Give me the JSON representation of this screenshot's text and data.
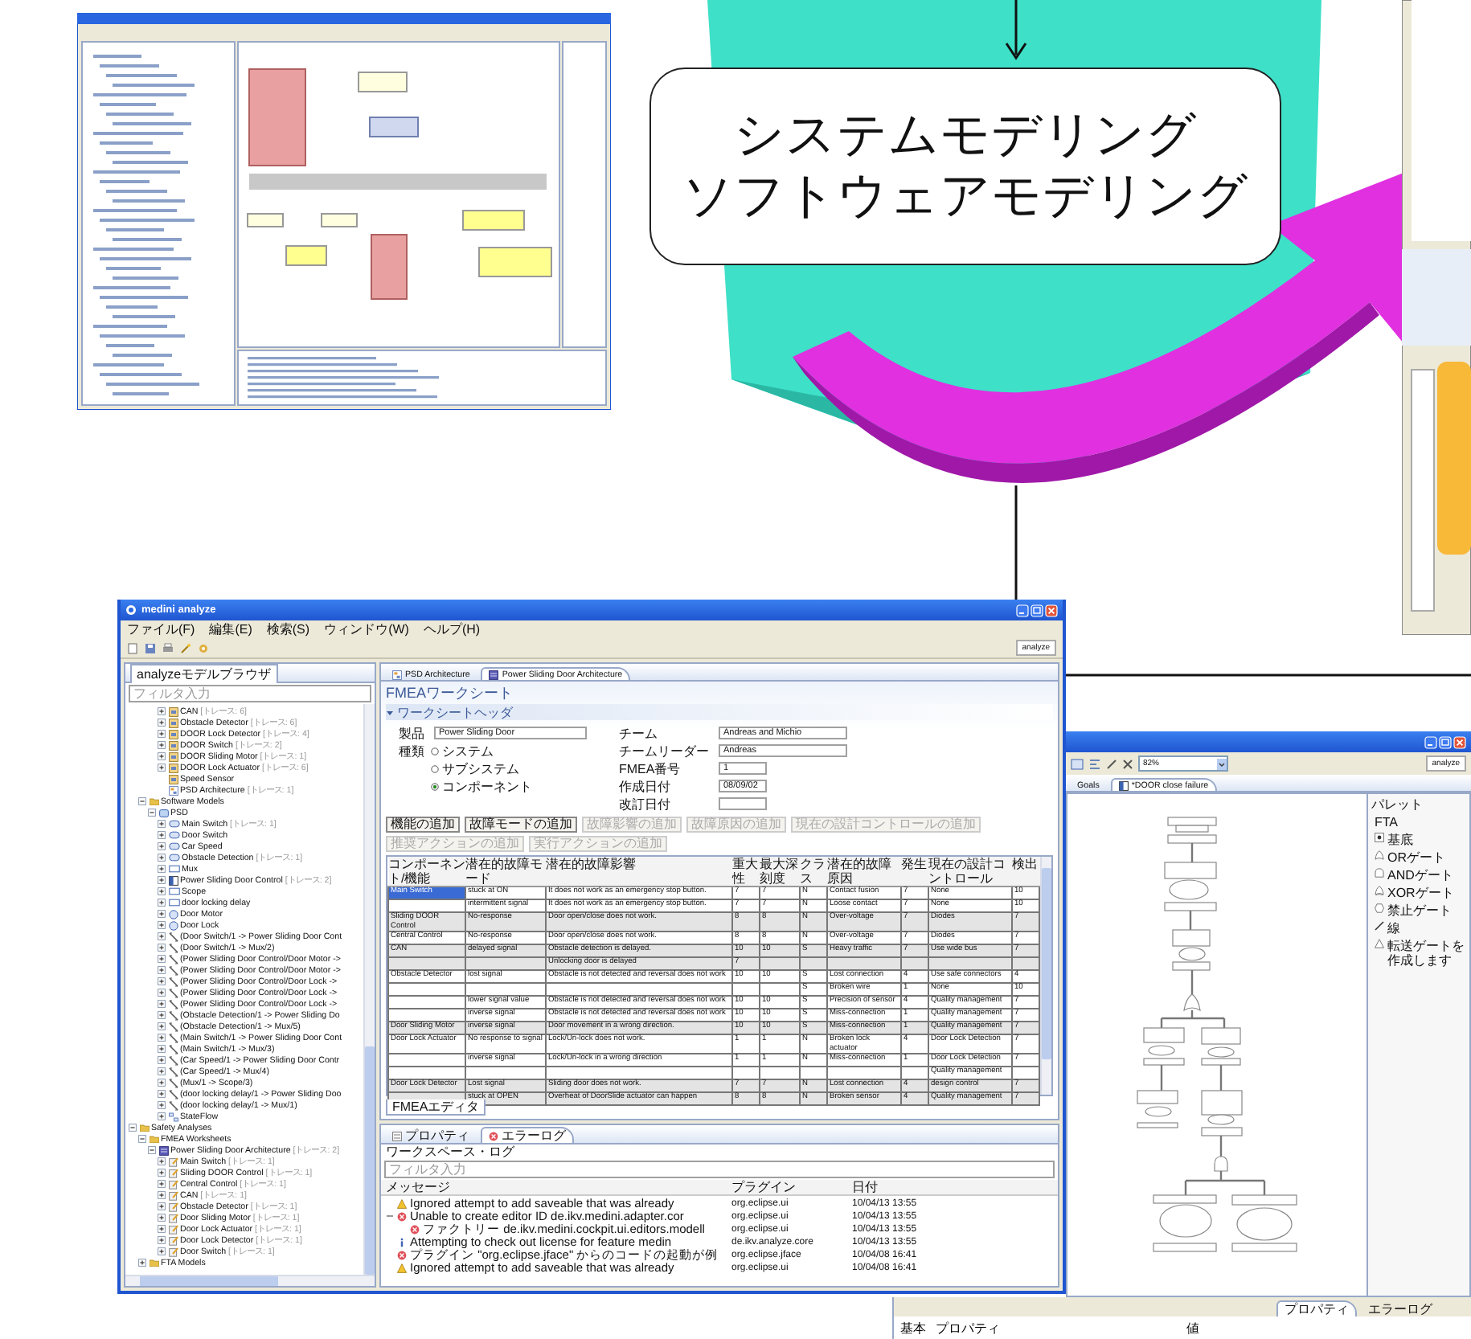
{
  "label_box": {
    "lines": [
      "システムモデリング",
      "ソフトウェアモデリング"
    ]
  },
  "main_window": {
    "title": "medini analyze",
    "menu": [
      "ファイル(F)",
      "編集(E)",
      "検索(S)",
      "ウィンドウ(W)",
      "ヘルプ(H)"
    ],
    "perspective": "analyze",
    "explorer": {
      "tab": "analyzeモデルブラウザ",
      "filter_placeholder": "フィルタ入力",
      "tree": [
        {
          "children": [
            {
              "children": [
                {
                  "children": [
                    {
                      "label": "CAN",
                      "trace": "[トレース: 6]",
                      "kind": "component",
                      "expanded": false
                    },
                    {
                      "label": "Obstacle Detector",
                      "trace": "[トレース: 6]",
                      "kind": "component",
                      "expanded": false
                    },
                    {
                      "label": "DOOR Lock Detector",
                      "trace": "[トレース: 4]",
                      "kind": "component",
                      "expanded": false
                    },
                    {
                      "label": "DOOR Switch",
                      "trace": "[トレース: 2]",
                      "kind": "component",
                      "expanded": false
                    },
                    {
                      "label": "DOOR Sliding Motor",
                      "trace": "[トレース: 1]",
                      "kind": "component",
                      "expanded": false
                    },
                    {
                      "label": "DOOR Lock Actuator",
                      "trace": "[トレース: 6]",
                      "kind": "component",
                      "expanded": false
                    },
                    {
                      "label": "Speed Sensor",
                      "kind": "component"
                    },
                    {
                      "label": "PSD Architecture",
                      "trace": "[トレース: 1]",
                      "kind": "diagram"
                    }
                  ]
                }
              ]
            },
            {
              "label": "Software Models",
              "kind": "folder",
              "expanded": true,
              "children": [
                {
                  "label": "PSD",
                  "kind": "model",
                  "expanded": true,
                  "children": [
                    {
                      "label": "Main Switch",
                      "trace": "[トレース: 1]",
                      "kind": "inport",
                      "expanded": false
                    },
                    {
                      "label": "Door Switch",
                      "kind": "inport",
                      "expanded": false
                    },
                    {
                      "label": "Car Speed",
                      "kind": "inport",
                      "expanded": false
                    },
                    {
                      "label": "Obstacle Detection",
                      "trace": "[トレース: 1]",
                      "kind": "inport",
                      "expanded": false
                    },
                    {
                      "label": "Mux",
                      "kind": "subsystem",
                      "expanded": false
                    },
                    {
                      "label": "Power Sliding Door Control",
                      "trace": "[トレース: 2]",
                      "kind": "chart",
                      "expanded": false
                    },
                    {
                      "label": "Scope",
                      "kind": "subsystem",
                      "expanded": false
                    },
                    {
                      "label": "door locking delay",
                      "kind": "subsystem",
                      "expanded": false
                    },
                    {
                      "label": "Door Motor",
                      "kind": "outport",
                      "expanded": false
                    },
                    {
                      "label": "Door Lock",
                      "kind": "outport",
                      "expanded": false
                    },
                    {
                      "label": "(Door Switch/1 -> Power Sliding Door Cont",
                      "kind": "connection",
                      "expanded": false
                    },
                    {
                      "label": "(Door Switch/1 -> Mux/2)",
                      "kind": "connection",
                      "expanded": false
                    },
                    {
                      "label": "(Power Sliding Door Control/Door Motor ->",
                      "kind": "connection",
                      "expanded": false
                    },
                    {
                      "label": "(Power Sliding Door Control/Door Motor ->",
                      "kind": "connection",
                      "expanded": false
                    },
                    {
                      "label": "(Power Sliding Door Control/Door Lock ->",
                      "kind": "connection",
                      "expanded": false
                    },
                    {
                      "label": "(Power Sliding Door Control/Door Lock ->",
                      "kind": "connection",
                      "expanded": false
                    },
                    {
                      "label": "(Power Sliding Door Control/Door Lock ->",
                      "kind": "connection",
                      "expanded": false
                    },
                    {
                      "label": "(Obstacle Detection/1 -> Power Sliding Do",
                      "kind": "connection",
                      "expanded": false
                    },
                    {
                      "label": "(Obstacle Detection/1 -> Mux/5)",
                      "kind": "connection",
                      "expanded": false
                    },
                    {
                      "label": "(Main Switch/1 -> Power Sliding Door Cont",
                      "kind": "connection",
                      "expanded": false
                    },
                    {
                      "label": "(Main Switch/1 -> Mux/3)",
                      "kind": "connection",
                      "expanded": false
                    },
                    {
                      "label": "(Car Speed/1 -> Power Sliding Door Contr",
                      "kind": "connection",
                      "expanded": false
                    },
                    {
                      "label": "(Car Speed/1 -> Mux/4)",
                      "kind": "connection",
                      "expanded": false
                    },
                    {
                      "label": "(Mux/1 -> Scope/3)",
                      "kind": "connection",
                      "expanded": false
                    },
                    {
                      "label": "(door locking delay/1 -> Power Sliding Doo",
                      "kind": "connection",
                      "expanded": false
                    },
                    {
                      "label": "(door locking delay/1 -> Mux/1)",
                      "kind": "connection",
                      "expanded": false
                    },
                    {
                      "label": "StateFlow",
                      "kind": "statechart",
                      "expanded": false
                    }
                  ]
                }
              ]
            }
          ]
        },
        {
          "label": "Safety Analyses",
          "kind": "folder",
          "expanded": true,
          "children": [
            {
              "label": "FMEA Worksheets",
              "kind": "folder",
              "expanded": true,
              "children": [
                {
                  "label": "Power Sliding Door Architecture",
                  "trace": "[トレース: 2]",
                  "kind": "worksheet",
                  "expanded": true,
                  "children": [
                    {
                      "label": "Main Switch",
                      "trace": "[トレース: 1]",
                      "kind": "fmea-item",
                      "expanded": false
                    },
                    {
                      "label": "Sliding DOOR Control",
                      "trace": "[トレース: 1]",
                      "kind": "fmea-item",
                      "expanded": false
                    },
                    {
                      "label": "Central Control",
                      "trace": "[トレース: 1]",
                      "kind": "fmea-item",
                      "expanded": false
                    },
                    {
                      "label": "CAN",
                      "trace": "[トレース: 1]",
                      "kind": "fmea-item",
                      "expanded": false
                    },
                    {
                      "label": "Obstacle Detector",
                      "trace": "[トレース: 1]",
                      "kind": "fmea-item",
                      "expanded": false
                    },
                    {
                      "label": "Door Sliding Motor",
                      "trace": "[トレース: 1]",
                      "kind": "fmea-item",
                      "expanded": false
                    },
                    {
                      "label": "Door Lock Actuator",
                      "trace": "[トレース: 1]",
                      "kind": "fmea-item",
                      "expanded": false
                    },
                    {
                      "label": "Door Lock Detector",
                      "trace": "[トレース: 1]",
                      "kind": "fmea-item",
                      "expanded": false
                    },
                    {
                      "label": "Door Switch",
                      "trace": "[トレース: 1]",
                      "kind": "fmea-item",
                      "expanded": false
                    }
                  ]
                }
              ]
            },
            {
              "label": "FTA Models",
              "kind": "folder",
              "expanded": false
            }
          ]
        }
      ]
    },
    "editor": {
      "tabs": [
        {
          "label": "PSD Architecture",
          "kind": "diagram",
          "selected": false
        },
        {
          "label": "Power Sliding Door Architecture",
          "kind": "worksheet",
          "selected": true
        }
      ],
      "heading": "FMEAワークシート",
      "section": {
        "title": "ワークシートヘッダ",
        "expanded": true
      },
      "product": {
        "label": "製品",
        "value": "Power Sliding Door"
      },
      "type_label": "種類",
      "type_options": [
        {
          "label": "システム",
          "selected": false
        },
        {
          "label": "サブシステム",
          "selected": false
        },
        {
          "label": "コンポーネント",
          "selected": true
        }
      ],
      "fields": [
        {
          "label": "チーム",
          "value": "Andreas and Michio"
        },
        {
          "label": "チームリーダー",
          "value": "Andreas"
        },
        {
          "label": "FMEA番号",
          "value": "1"
        },
        {
          "label": "作成日付",
          "value": "08/09/02"
        },
        {
          "label": "改訂日付"
        }
      ],
      "actions": [
        {
          "label": "機能の追加",
          "disabled": false
        },
        {
          "label": "故障モードの追加",
          "disabled": false
        },
        {
          "label": "故障影響の追加",
          "disabled": true
        },
        {
          "label": "故障原因の追加",
          "disabled": true
        },
        {
          "label": "現在の設計コントロールの追加",
          "disabled": true
        },
        {
          "label": "推奨アクションの追加",
          "disabled": true
        },
        {
          "label": "実行アクションの追加",
          "disabled": true
        }
      ],
      "table": {
        "columns": [
          "コンポーネント/機能",
          "潜在的故障モード",
          "潜在的故障影響",
          "重大性",
          "最大深刻度",
          "クラス",
          "潜在的故障原因",
          "発生",
          "現在の設計コントロール",
          "検出"
        ],
        "rows": [
          {
            "shaded": false,
            "selected": true,
            "cells": [
              "Main Switch",
              "stuck at ON",
              "It does not work as an emergency stop button.",
              "7",
              "7",
              "N",
              "Contact fusion",
              "7",
              "None",
              "10"
            ]
          },
          {
            "shaded": false,
            "selected": false,
            "cells": [
              null,
              "intermittent signal",
              "It does not work as an emergency stop button.",
              "7",
              "7",
              "N",
              "Loose contact",
              "7",
              "None",
              "10"
            ]
          },
          {
            "shaded": true,
            "selected": false,
            "cells": [
              "Sliding DOOR Control",
              "No-response",
              "Door open/close does not work.",
              "8",
              "8",
              "N",
              "Over-voltage",
              "7",
              "Diodes",
              "7"
            ]
          },
          {
            "shaded": false,
            "selected": false,
            "cells": [
              "Central Control",
              "No-response",
              "Door open/close does not work.",
              "8",
              "8",
              "N",
              "Over-voltage",
              "7",
              "Diodes",
              "7"
            ]
          },
          {
            "shaded": true,
            "selected": false,
            "cells": [
              "CAN",
              "delayed signal",
              "Obstacle detection is delayed.",
              "10",
              "10",
              "S",
              "Heavy traffic",
              "7",
              "Use wide bus",
              "7"
            ]
          },
          {
            "shaded": true,
            "selected": false,
            "cells": [
              null,
              null,
              "Unlocking door is delayed",
              "7",
              null,
              null,
              null,
              null,
              null,
              null
            ]
          },
          {
            "shaded": false,
            "selected": false,
            "cells": [
              "Obstacle Detector",
              "lost signal",
              "Obstacle is not detected and reversal does not work",
              "10",
              "10",
              "S",
              "Lost connection",
              "4",
              "Use safe connectors",
              "4"
            ]
          },
          {
            "shaded": false,
            "selected": false,
            "cells": [
              null,
              null,
              null,
              null,
              null,
              "S",
              "Broken wire",
              "1",
              "None",
              "10"
            ]
          },
          {
            "shaded": false,
            "selected": false,
            "cells": [
              null,
              "lower signal value",
              "Obstacle is not detected and reversal does not work",
              "10",
              "10",
              "S",
              "Precision of sensor",
              "4",
              "Quality management",
              "7"
            ]
          },
          {
            "shaded": false,
            "selected": false,
            "cells": [
              null,
              "inverse signal",
              "Obstacle is not detected and reversal does not work",
              "10",
              "10",
              "S",
              "Miss-connection",
              "1",
              "Quality management",
              "7"
            ]
          },
          {
            "shaded": true,
            "selected": false,
            "cells": [
              "Door Sliding Motor",
              "inverse signal",
              "Door movement in a wrong direction.",
              "10",
              "10",
              "S",
              "Miss-connection",
              "1",
              "Quality management",
              "7"
            ]
          },
          {
            "shaded": false,
            "selected": false,
            "cells": [
              "Door Lock Actuator",
              "No response to signal",
              "Lock/Un-lock does not work.",
              "1",
              "1",
              "N",
              "Broken lock actuator",
              "4",
              "Door Lock Detection",
              "7"
            ]
          },
          {
            "shaded": false,
            "selected": false,
            "cells": [
              null,
              "inverse signal",
              "Lock/Un-lock in a wrong direction",
              "1",
              "1",
              "N",
              "Miss-connection",
              "1",
              "Door Lock Detection",
              "7"
            ]
          },
          {
            "shaded": false,
            "selected": false,
            "cells": [
              null,
              null,
              null,
              null,
              null,
              null,
              null,
              null,
              "Quality management",
              null
            ]
          },
          {
            "shaded": true,
            "selected": false,
            "cells": [
              "Door Lock Detector",
              "Lost signal",
              "Sliding door does not work.",
              "7",
              "7",
              "N",
              "Lost connection",
              "4",
              "design control",
              "7"
            ]
          },
          {
            "shaded": true,
            "selected": false,
            "cells": [
              null,
              "stuck at OPEN",
              "Overheat of DoorSlide actuator can happen",
              "8",
              "8",
              "N",
              "Broken sensor",
              "4",
              "Quality management",
              "7"
            ]
          }
        ]
      },
      "bottom_tab": "FMEAエディタ"
    },
    "log": {
      "tabs": [
        {
          "label": "プロパティ",
          "kind": "properties",
          "selected": false
        },
        {
          "label": "エラーログ",
          "kind": "errors",
          "selected": true
        }
      ],
      "subtitle": "ワークスペース・ログ",
      "filter_placeholder": "フィルタ入力",
      "columns": [
        "メッセージ",
        "プラグイン",
        "日付"
      ],
      "rows": [
        {
          "kind": "warning",
          "message": "Ignored attempt to add saveable that was already",
          "plugin": "org.eclipse.ui",
          "date": "10/04/13 13:55"
        },
        {
          "kind": "error",
          "expanded": true,
          "message": "Unable to create editor ID de.ikv.medini.adapter.cor",
          "plugin": "org.eclipse.ui",
          "date": "10/04/13 13:55",
          "children": [
            {
              "kind": "error",
              "message": "ファクトリー de.ikv.medini.cockpit.ui.editors.modell",
              "plugin": "org.eclipse.ui",
              "date": "10/04/13 13:55"
            }
          ]
        },
        {
          "kind": "info",
          "message": "Attempting to check out license for feature medin",
          "plugin": "de.ikv.analyze.core",
          "date": "10/04/13 13:55"
        },
        {
          "kind": "error",
          "message": "プラグイン \"org.eclipse.jface\" からのコードの起動が例",
          "plugin": "org.eclipse.jface",
          "date": "10/04/08 16:41"
        },
        {
          "kind": "warning",
          "message": "Ignored attempt to add saveable that was already",
          "plugin": "org.eclipse.ui",
          "date": "10/04/08 16:41"
        }
      ]
    }
  },
  "fta_window": {
    "zoom": "82%",
    "perspective": "analyze",
    "tabs": [
      {
        "label": "Goals",
        "selected": false
      },
      {
        "label": "*DOOR close failure",
        "selected": true
      }
    ],
    "palette": {
      "title": "パレット",
      "group": "FTA",
      "items": [
        {
          "label": "基底",
          "kind": "basic"
        },
        {
          "label": "ORゲート",
          "kind": "or"
        },
        {
          "label": "ANDゲート",
          "kind": "and"
        },
        {
          "label": "XORゲート",
          "kind": "xor"
        },
        {
          "label": "禁止ゲート",
          "kind": "inhibit"
        },
        {
          "label": "線",
          "kind": "line"
        },
        {
          "label": "転送ゲートを作成します",
          "kind": "transfer"
        }
      ]
    }
  },
  "properties_window": {
    "tabs": [
      {
        "label": "プロパティ",
        "selected": true
      },
      {
        "label": "エラーログ",
        "selected": false
      }
    ],
    "section": "基本",
    "columns": [
      "プロパティ",
      "値"
    ]
  }
}
